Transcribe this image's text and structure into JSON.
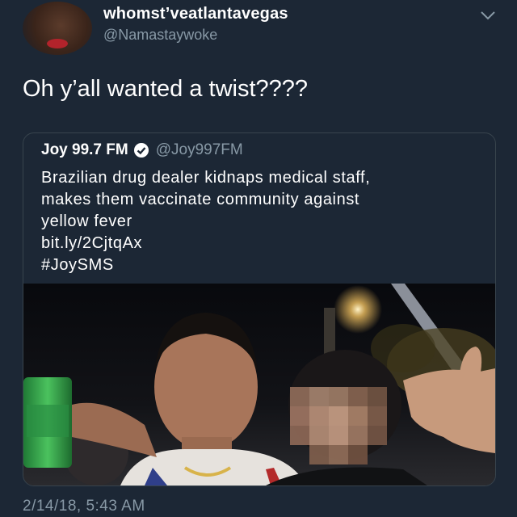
{
  "author": {
    "display_name": "whomst’veatlantavegas",
    "handle": "@Namastaywoke"
  },
  "tweet": {
    "text": "Oh y’all wanted a twist????",
    "timestamp": "2/14/18, 5:43 AM"
  },
  "quoted_tweet": {
    "name": "Joy 99.7 FM",
    "handle": "@Joy997FM",
    "lines": [
      "Brazilian drug dealer kidnaps medical staff,",
      "makes them vaccinate community against",
      "yellow fever",
      "bit.ly/2CjtqAx",
      "#JoySMS"
    ]
  },
  "icons": {
    "caret": "chevron-down-icon",
    "verified": "verified-badge-icon"
  },
  "colors": {
    "background": "#1c2735",
    "secondary_text": "#8899a6",
    "border": "#38444d"
  }
}
